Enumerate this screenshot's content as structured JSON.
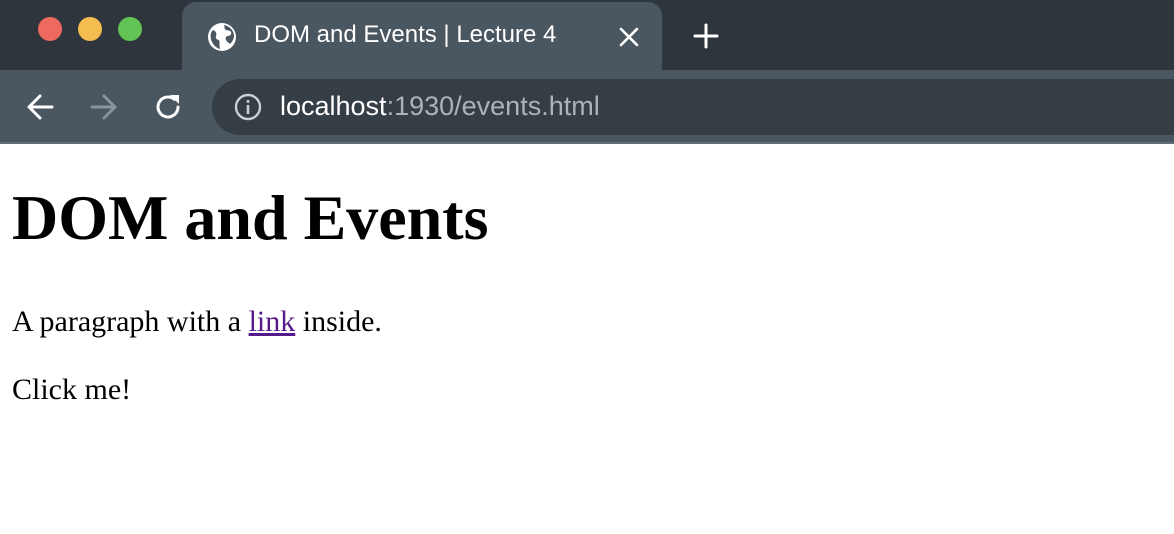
{
  "window": {
    "controls": {
      "close_color": "#ee6a5f",
      "minimize_color": "#f5bd4f",
      "maximize_color": "#61c454"
    }
  },
  "tab": {
    "title": "DOM and Events | Lecture 4",
    "favicon": "globe-icon"
  },
  "toolbar": {
    "back_icon": "back-arrow-icon",
    "forward_icon": "forward-arrow-icon",
    "reload_icon": "reload-icon",
    "site_info_icon": "info-icon",
    "url_host": "localhost",
    "url_rest": ":1930/events.html"
  },
  "page": {
    "heading": "DOM and Events",
    "paragraph_before": "A paragraph with a ",
    "link_text": "link",
    "paragraph_after": " inside.",
    "click_text": "Click me!",
    "link_color": "#551a8b"
  }
}
